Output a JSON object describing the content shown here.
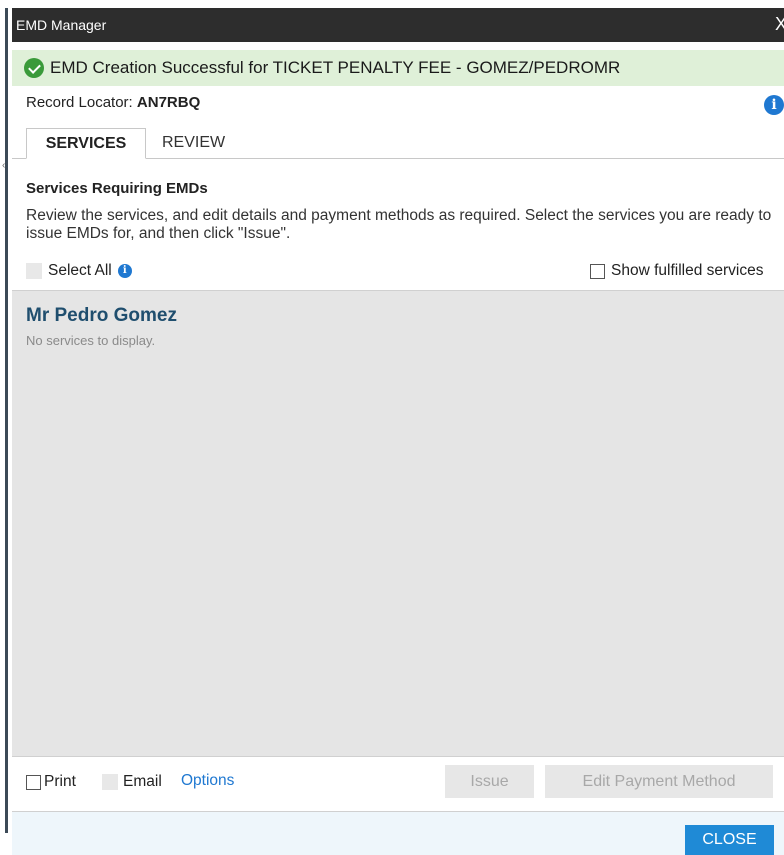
{
  "window": {
    "title": "EMD Manager",
    "close_glyph": "X"
  },
  "banner": {
    "icon": "check-circle-icon",
    "message": "EMD Creation Successful for TICKET PENALTY FEE - GOMEZ/PEDROMR"
  },
  "record": {
    "label": "Record Locator:",
    "value": "AN7RBQ"
  },
  "tabs": [
    {
      "label": "SERVICES",
      "active": true
    },
    {
      "label": "REVIEW",
      "active": false
    }
  ],
  "section": {
    "heading": "Services Requiring EMDs",
    "description": "Review the services, and edit details and payment methods as required. Select the services you are ready to issue EMDs for, and then click \"Issue\".",
    "select_all": "Select All",
    "show_fulfilled": "Show fulfilled services"
  },
  "passenger": {
    "name": "Mr Pedro Gomez",
    "empty_text": "No services to display."
  },
  "footer": {
    "print": "Print",
    "email": "Email",
    "options": "Options",
    "issue": "Issue",
    "edit_payment": "Edit Payment Method"
  },
  "close_button": "CLOSE",
  "colors": {
    "accent": "#1f8ad6",
    "success_bg": "#dff0d8",
    "titlebar": "#2d2d2d",
    "name": "#1f4e6e"
  }
}
